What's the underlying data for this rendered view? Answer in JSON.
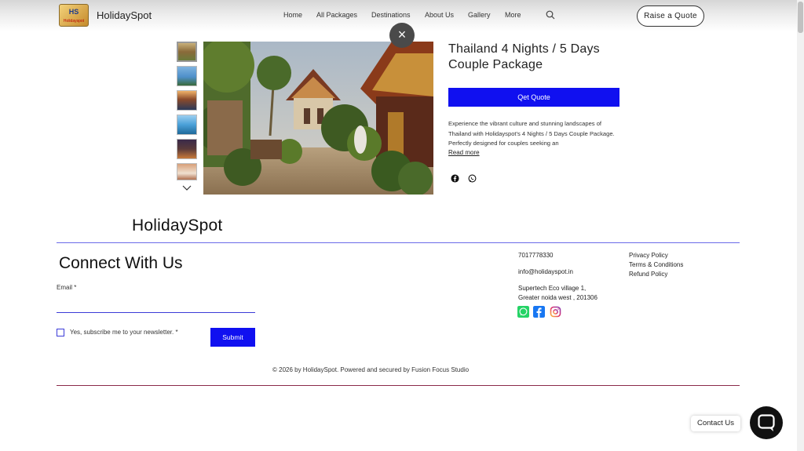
{
  "header": {
    "logo_text": "HS",
    "logo_subtext": "Holidayspot",
    "brand": "HolidaySpot",
    "nav": [
      "Home",
      "All Packages",
      "Destinations",
      "About Us",
      "Gallery",
      "More"
    ],
    "cta": "Raise a Quote"
  },
  "gallery": {
    "thumbnail_count": 6,
    "close_symbol": "×"
  },
  "package": {
    "title_line1": "Thailand 4 Nights / 5 Days",
    "title_line2": "Couple Package",
    "quote_button": "Qet Quote",
    "description": "Experience the vibrant culture and stunning landscapes of Thailand with Holidayspot's 4 Nights / 5 Days Couple Package. Perfectly designed for couples seeking an",
    "read_more": "Read more",
    "share_icons": [
      "facebook-icon",
      "whatsapp-icon"
    ]
  },
  "footer": {
    "brand": "HolidaySpot",
    "connect_title": "Connect With Us",
    "email_label": "Email *",
    "newsletter_label": "Yes, subscribe me to your newsletter. *",
    "submit": "Submit",
    "phone": "7017778330",
    "email": "info@holidayspot.in",
    "address_line1": "Supertech Eco village 1,",
    "address_line2": "Greater noida west , 201306",
    "links": [
      "Privacy Policy",
      "Terms & Conditions",
      "Refund Policy"
    ],
    "social": [
      "whatsapp-icon",
      "facebook-icon",
      "instagram-icon"
    ],
    "copyright": "© 2026 by HolidaySpot. Powered and secured by Fusion Focus Studio"
  },
  "chat": {
    "label": "Contact Us"
  },
  "colors": {
    "accent": "#1010f0",
    "divider": "#6a6ae8"
  }
}
